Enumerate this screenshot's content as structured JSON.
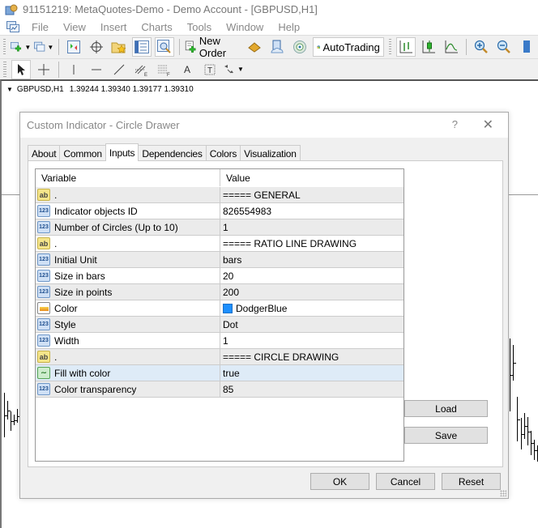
{
  "window": {
    "title": "91151219: MetaQuotes-Demo - Demo Account - [GBPUSD,H1]"
  },
  "menu": [
    "File",
    "View",
    "Insert",
    "Charts",
    "Tools",
    "Window",
    "Help"
  ],
  "toolbar": {
    "new_order_label": "New Order",
    "autotrading_label": "AutoTrading"
  },
  "chart": {
    "symbol": "GBPUSD,H1",
    "ohlc": "1.39244 1.39340 1.39177 1.39310"
  },
  "dialog": {
    "title": "Custom Indicator - Circle Drawer",
    "help_label": "?",
    "tabs": [
      "About",
      "Common",
      "Inputs",
      "Dependencies",
      "Colors",
      "Visualization"
    ],
    "active_tab": "Inputs",
    "grid": {
      "headers": [
        "Variable",
        "Value"
      ],
      "rows": [
        {
          "icon": "ab",
          "variable": ".",
          "value": "===== GENERAL"
        },
        {
          "icon": "123",
          "variable": "Indicator objects ID",
          "value": "826554983"
        },
        {
          "icon": "123",
          "variable": "Number of Circles (Up to 10)",
          "value": "1"
        },
        {
          "icon": "ab",
          "variable": ".",
          "value": "===== RATIO LINE DRAWING"
        },
        {
          "icon": "123",
          "variable": "Initial Unit",
          "value": "bars"
        },
        {
          "icon": "123",
          "variable": "Size in bars",
          "value": "20"
        },
        {
          "icon": "123",
          "variable": "Size in points",
          "value": "200"
        },
        {
          "icon": "color",
          "variable": "Color",
          "value": "DodgerBlue",
          "swatch": "#1e90ff"
        },
        {
          "icon": "123",
          "variable": "Style",
          "value": "Dot"
        },
        {
          "icon": "123",
          "variable": "Width",
          "value": "1"
        },
        {
          "icon": "ab",
          "variable": ".",
          "value": "===== CIRCLE DRAWING"
        },
        {
          "icon": "bool",
          "variable": "Fill with color",
          "value": "true"
        },
        {
          "icon": "123",
          "variable": "Color transparency",
          "value": "85"
        }
      ]
    },
    "buttons": {
      "load": "Load",
      "save": "Save",
      "ok": "OK",
      "cancel": "Cancel",
      "reset": "Reset"
    }
  }
}
